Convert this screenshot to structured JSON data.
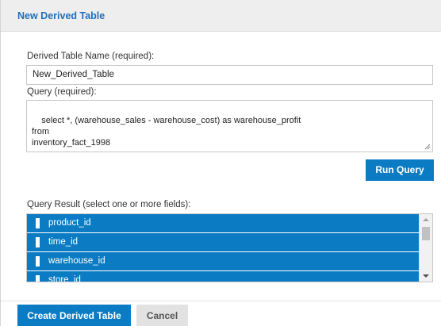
{
  "dialog": {
    "title": "New Derived Table"
  },
  "form": {
    "name_label": "Derived Table Name (required):",
    "name_value": "New_Derived_Table",
    "query_label": "Query (required):",
    "query_value": "select *, (warehouse_sales - warehouse_cost) as warehouse_profit\nfrom\ninventory_fact_1998",
    "run_query_label": "Run Query",
    "result_label": "Query Result (select one or more fields):",
    "result_items": [
      "product_id",
      "time_id",
      "warehouse_id",
      "store_id"
    ]
  },
  "footer": {
    "create_label": "Create Derived Table",
    "cancel_label": "Cancel"
  },
  "colors": {
    "accent": "#0b7cc4",
    "title_text": "#1f6fbf"
  },
  "icons": {
    "field": "field-icon",
    "resize": "resize-grip-icon"
  }
}
